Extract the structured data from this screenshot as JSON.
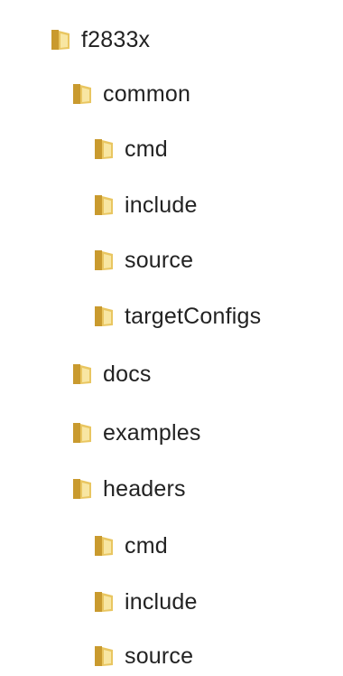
{
  "tree": {
    "items": [
      {
        "label": "f2833x",
        "depth": 0
      },
      {
        "label": "common",
        "depth": 1
      },
      {
        "label": "cmd",
        "depth": 2
      },
      {
        "label": "include",
        "depth": 2
      },
      {
        "label": "source",
        "depth": 2
      },
      {
        "label": "targetConfigs",
        "depth": 2
      },
      {
        "label": "docs",
        "depth": 1
      },
      {
        "label": "examples",
        "depth": 1
      },
      {
        "label": "headers",
        "depth": 1
      },
      {
        "label": "cmd",
        "depth": 2
      },
      {
        "label": "include",
        "depth": 2
      },
      {
        "label": "source",
        "depth": 2
      }
    ]
  },
  "icon": "folder-icon",
  "colors": {
    "folder_light": "#F8E6A2",
    "folder_mid": "#E9C661",
    "folder_dark": "#C99A2E",
    "text": "#222222"
  }
}
